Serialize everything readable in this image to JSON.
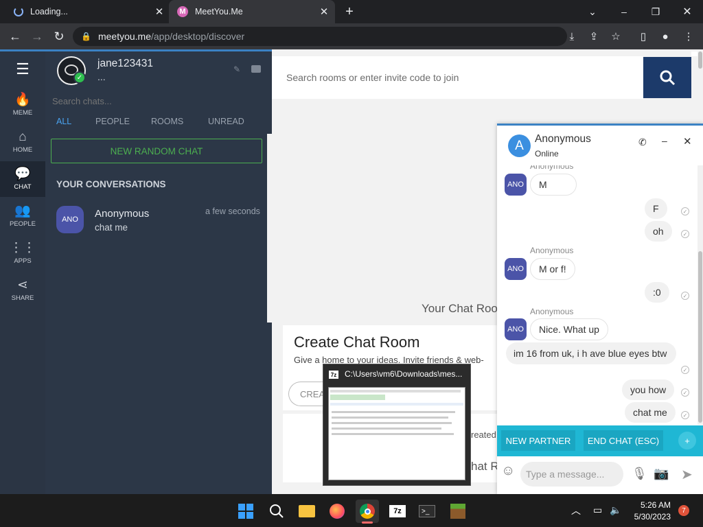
{
  "browser": {
    "tabs": [
      {
        "label": "Loading..."
      },
      {
        "label": "MeetYou.Me",
        "favicon": "M"
      }
    ],
    "url_host": "meetyou.me",
    "url_path": "/app/desktop/discover"
  },
  "nav": {
    "items": [
      {
        "label": "MEME",
        "icon": "flame-icon"
      },
      {
        "label": "HOME",
        "icon": "home-icon"
      },
      {
        "label": "CHAT",
        "icon": "chat-icon"
      },
      {
        "label": "PEOPLE",
        "icon": "people-icon"
      },
      {
        "label": "APPS",
        "icon": "apps-grid-icon"
      },
      {
        "label": "SHARE",
        "icon": "share-icon"
      }
    ]
  },
  "profile": {
    "username": "jane123431",
    "status": "..."
  },
  "chats": {
    "search_placeholder": "Search chats...",
    "filters": [
      "ALL",
      "PEOPLE",
      "ROOMS",
      "UNREAD"
    ],
    "new_random_chat": "NEW RANDOM CHAT",
    "section_title": "YOUR CONVERSATIONS",
    "conversations": [
      {
        "avatar": "ANO",
        "name": "Anonymous",
        "preview": "chat me",
        "time": "a few seconds"
      }
    ]
  },
  "main": {
    "search_placeholder": "Search rooms or enter invite code to join",
    "your_rooms_title": "Your Chat Roo",
    "create_title": "Create Chat Room",
    "create_desc": "Give a home to your ideas. Invite friends & web-",
    "create_button": "CREA",
    "created_fragment": "reated",
    "rooms_fragment": "hat R"
  },
  "chat_window": {
    "header_avatar": "A",
    "name": "Anonymous",
    "status": "Online",
    "messages": [
      {
        "from": "them",
        "sender": "Anonymous",
        "avatar": "ANO",
        "text": "M"
      },
      {
        "from": "me",
        "text": "F"
      },
      {
        "from": "me",
        "text": "oh"
      },
      {
        "from": "them",
        "sender": "Anonymous",
        "avatar": "ANO",
        "text": "M or f!"
      },
      {
        "from": "me",
        "text": ":0"
      },
      {
        "from": "them",
        "sender": "Anonymous",
        "avatar": "ANO",
        "text": "Nice. What up"
      },
      {
        "from": "me",
        "text": "im 16 from uk, i h ave blue eyes btw"
      },
      {
        "from": "me",
        "text": "you how"
      },
      {
        "from": "me",
        "text": "chat me"
      }
    ],
    "new_partner": "NEW PARTNER",
    "end_chat": "END CHAT (ESC)",
    "input_placeholder": "Type a message..."
  },
  "thumbnail": {
    "title": "C:\\Users\\vm6\\Downloads\\mes..."
  },
  "taskbar": {
    "time": "5:26 AM",
    "date": "5/30/2023",
    "notification_count": "7",
    "apps": [
      "windows-start-icon",
      "search-icon",
      "file-explorer-icon",
      "firefox-icon",
      "chrome-icon",
      "7zip-icon",
      "terminal-icon",
      "minecraft-icon"
    ]
  },
  "colors": {
    "accent": "#3b82c4",
    "chat_action_bar": "#1fb7d4",
    "search_button": "#1c3a6a",
    "new_chat_green": "#4caf50",
    "avatar_purple": "#4b54a8"
  }
}
